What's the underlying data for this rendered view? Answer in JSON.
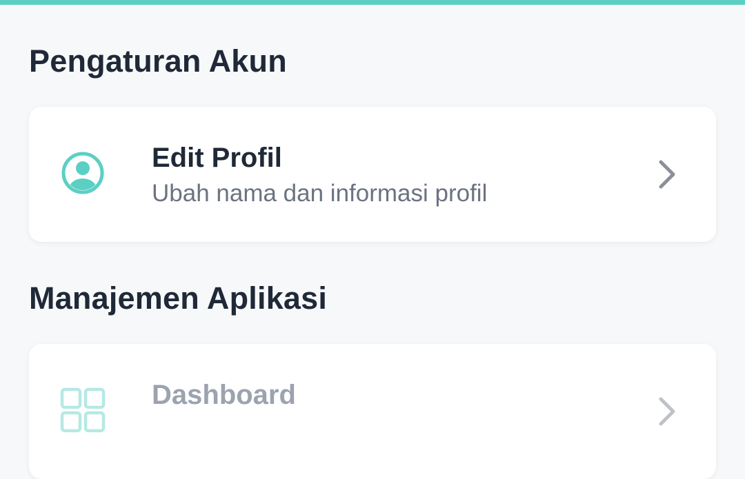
{
  "colors": {
    "accent": "#5ccfc4",
    "background": "#f7f8fa",
    "card": "#ffffff",
    "title_text": "#1f2937",
    "sub_text": "#6b7280",
    "chevron": "#8a8f98"
  },
  "sections": {
    "account": {
      "title": "Pengaturan Akun",
      "items": [
        {
          "icon": "user-circle-icon",
          "title": "Edit Profil",
          "subtitle": "Ubah nama dan informasi profil"
        }
      ]
    },
    "app": {
      "title": "Manajemen Aplikasi",
      "items": [
        {
          "icon": "grid-icon",
          "title": "Dashboard"
        }
      ]
    }
  }
}
